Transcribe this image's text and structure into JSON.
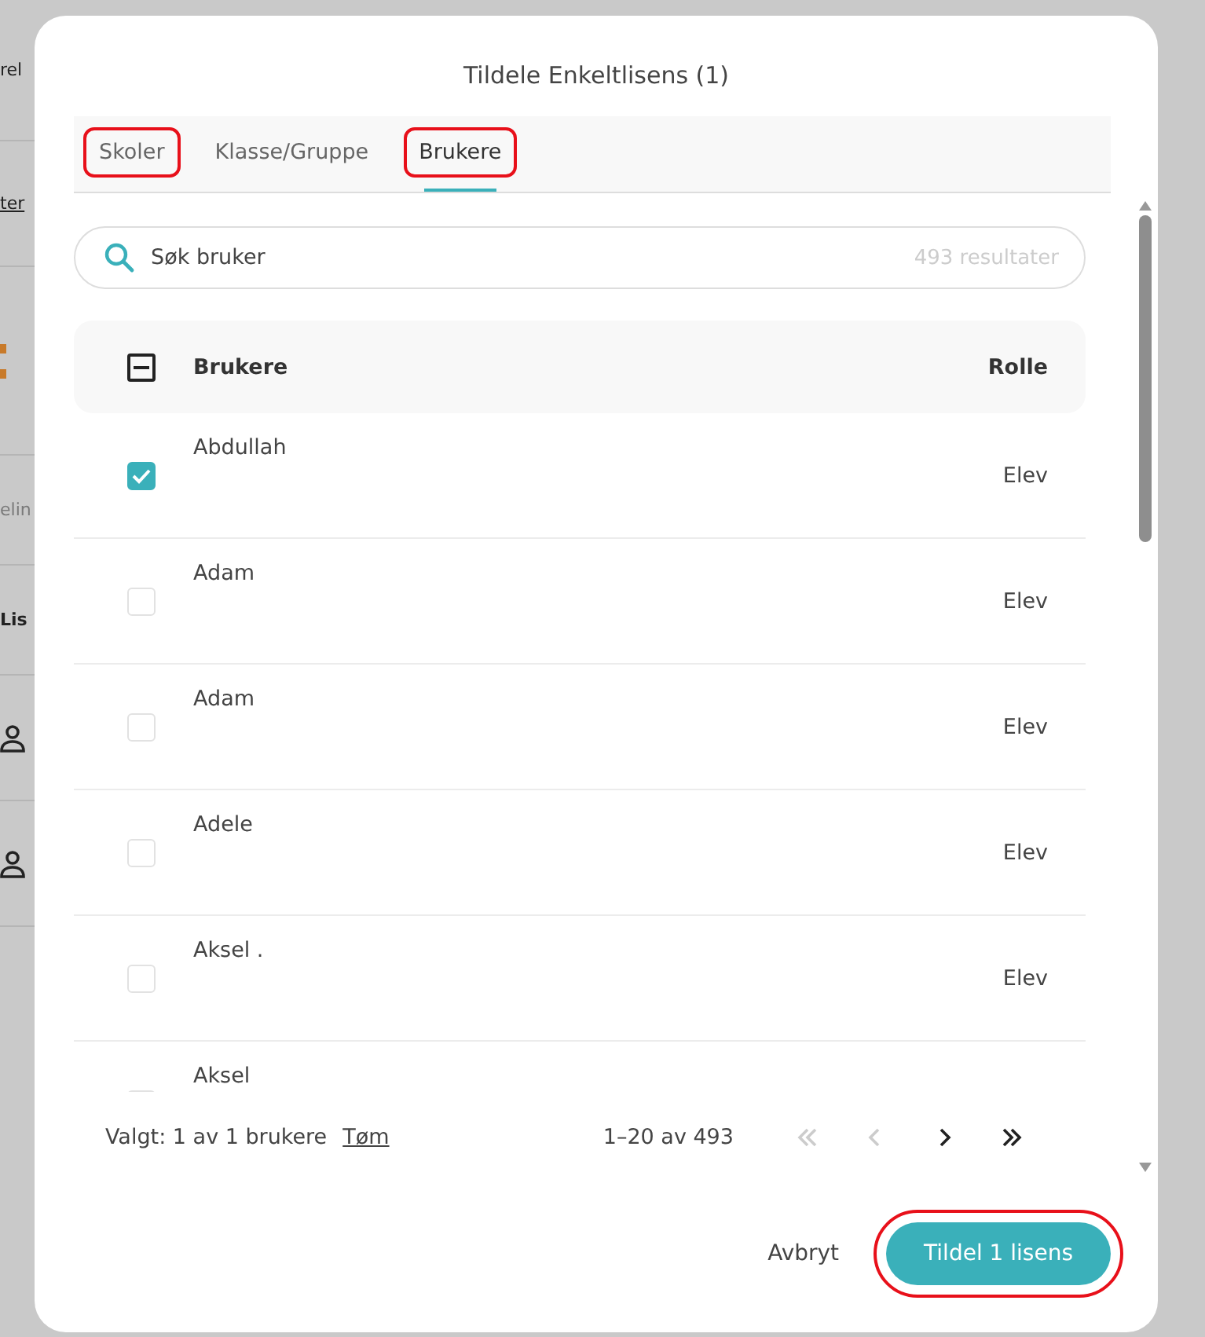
{
  "background_page": {
    "fragments": [
      {
        "kind": "text",
        "text": "rel"
      },
      {
        "kind": "link",
        "text": "ter"
      },
      {
        "kind": "accent"
      },
      {
        "kind": "muted",
        "text": "elin"
      },
      {
        "kind": "heading",
        "text": "Lis"
      },
      {
        "kind": "person"
      },
      {
        "kind": "person"
      }
    ]
  },
  "dialog": {
    "title": "Tildele Enkeltlisens (1)",
    "tabs": [
      {
        "label": "Skoler",
        "selected": false,
        "annotated": true
      },
      {
        "label": "Klasse/Gruppe",
        "selected": false,
        "annotated": false
      },
      {
        "label": "Brukere",
        "selected": true,
        "annotated": true
      }
    ],
    "search": {
      "value": "Søk bruker",
      "result_count": "493 resultater"
    },
    "table": {
      "columns": [
        "Brukere",
        "Rolle"
      ],
      "header_indeterminate": true,
      "rows": [
        {
          "name": "Abdullah",
          "role": "Elev",
          "checked": true
        },
        {
          "name": "Adam",
          "role": "Elev",
          "checked": false
        },
        {
          "name": "Adam",
          "role": "Elev",
          "checked": false
        },
        {
          "name": "Adele",
          "role": "Elev",
          "checked": false
        },
        {
          "name": "Aksel .",
          "role": "Elev",
          "checked": false
        },
        {
          "name": "Aksel",
          "checked": false
        }
      ]
    },
    "footer": {
      "selection": "Valgt: 1 av 1 brukere",
      "clear_link": "Tøm",
      "range": "1–20 av 493",
      "pager": [
        {
          "kind": "first",
          "disabled": true
        },
        {
          "kind": "prev",
          "disabled": true
        },
        {
          "kind": "next",
          "disabled": false
        },
        {
          "kind": "last",
          "disabled": false
        }
      ]
    },
    "buttons": [
      {
        "kind": "text",
        "label": "Avbryt",
        "annotated": false
      },
      {
        "kind": "primary",
        "label": "Tildel 1 lisens",
        "annotated": true
      }
    ]
  }
}
